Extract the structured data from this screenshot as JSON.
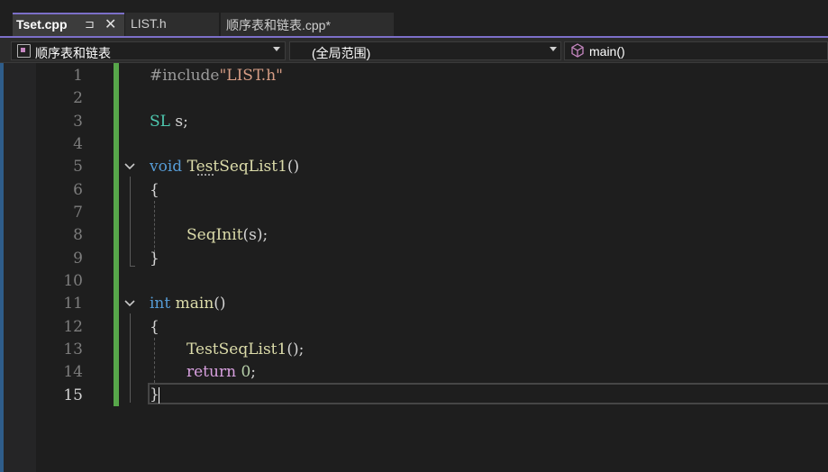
{
  "tabs": [
    {
      "label": "Tset.cpp",
      "active": true,
      "pin_icon": "pin-icon",
      "close_icon": "close-icon"
    },
    {
      "label": "LIST.h",
      "active": false
    },
    {
      "label": "顺序表和链表.cpp*",
      "active": false
    }
  ],
  "navbar": {
    "project": "顺序表和链表",
    "scope": "(全局范围)",
    "member": "main()"
  },
  "editor": {
    "current_line": 15,
    "line_numbers": [
      "1",
      "2",
      "3",
      "4",
      "5",
      "6",
      "7",
      "8",
      "9",
      "10",
      "11",
      "12",
      "13",
      "14",
      "15"
    ],
    "code": {
      "l1_directive": "#include",
      "l1_string": "\"LIST.h\"",
      "l3_type": "SL",
      "l3_rest": " s;",
      "l5_kw": "void",
      "l5_fn": "TestSeqList1",
      "l5_rest": "()",
      "l6": "{",
      "l8_fn": "SeqInit",
      "l8_rest": "(s);",
      "l9": "}",
      "l11_kw": "int",
      "l11_fn": "main",
      "l11_rest": "()",
      "l12": "{",
      "l13_fn": "TestSeqList1",
      "l13_rest": "();",
      "l14_kw": "return",
      "l14_num": "0",
      "l14_rest": ";",
      "l15": "}"
    }
  },
  "colors": {
    "accent": "#7c6fc8",
    "change_bar": "#57a64a",
    "keyword": "#569cd6",
    "function": "#dcdcaa",
    "type": "#4ec9b0",
    "string": "#d69d85"
  }
}
